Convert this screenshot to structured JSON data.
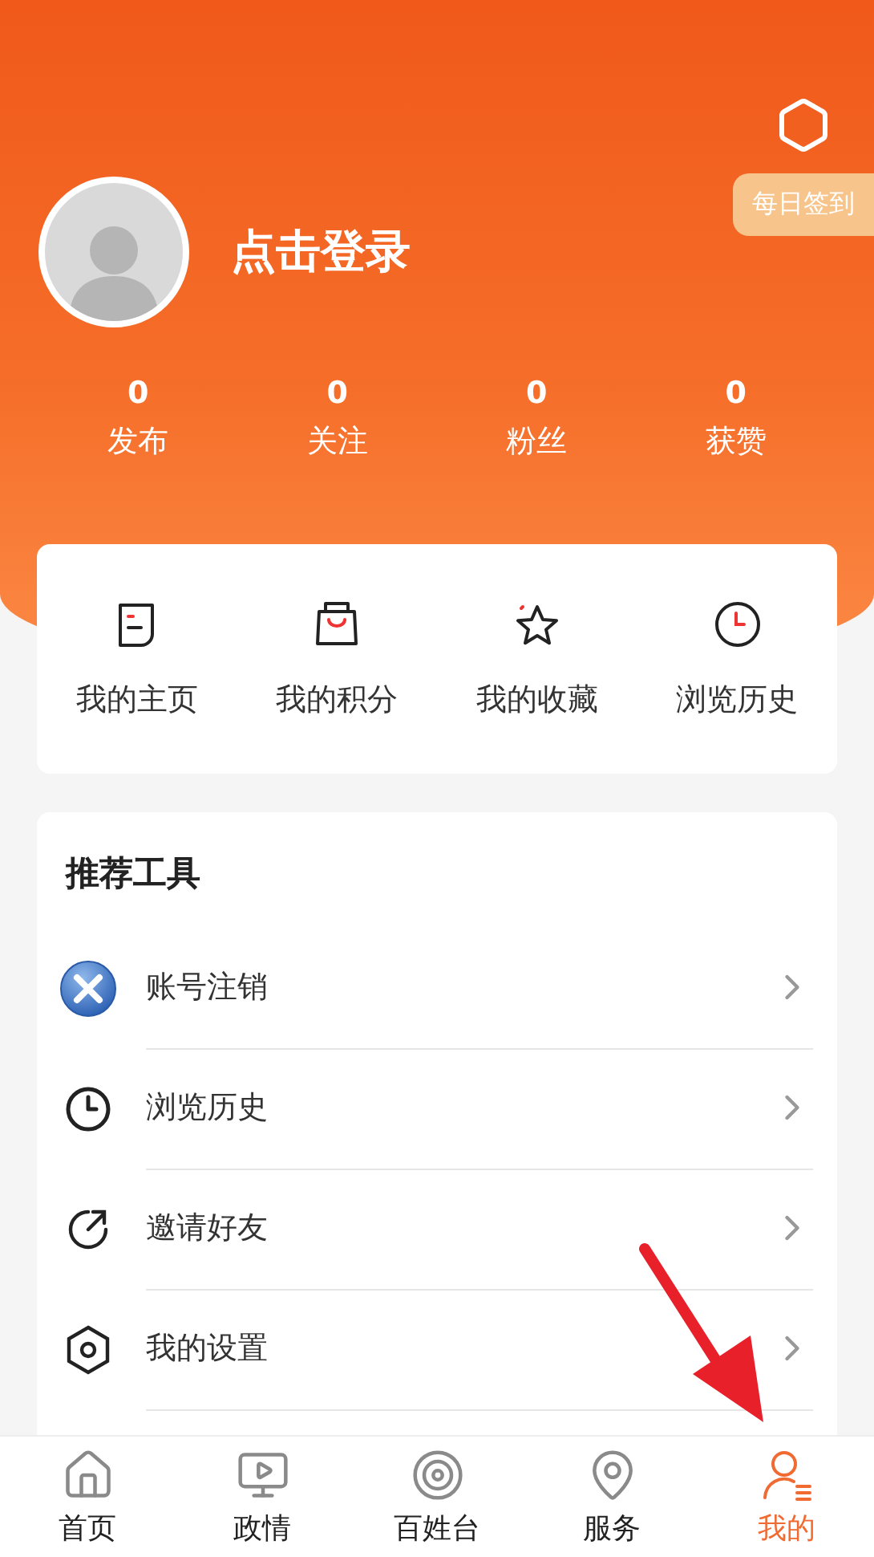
{
  "header": {
    "checkin": "每日签到",
    "login": "点击登录",
    "stats": [
      {
        "value": "0",
        "label": "发布"
      },
      {
        "value": "0",
        "label": "关注"
      },
      {
        "value": "0",
        "label": "粉丝"
      },
      {
        "value": "0",
        "label": "获赞"
      }
    ]
  },
  "shortcuts": [
    {
      "label": "我的主页",
      "kind": "page"
    },
    {
      "label": "我的积分",
      "kind": "bag"
    },
    {
      "label": "我的收藏",
      "kind": "star"
    },
    {
      "label": "浏览历史",
      "kind": "clock"
    }
  ],
  "tools": {
    "title": "推荐工具",
    "items": [
      {
        "label": "账号注销",
        "kind": "cancel"
      },
      {
        "label": "浏览历史",
        "kind": "clock"
      },
      {
        "label": "邀请好友",
        "kind": "share"
      },
      {
        "label": "我的设置",
        "kind": "settings"
      }
    ]
  },
  "tabbar": [
    {
      "label": "首页",
      "kind": "home",
      "selected": false
    },
    {
      "label": "政情",
      "kind": "video",
      "selected": false
    },
    {
      "label": "百姓台",
      "kind": "target",
      "selected": false
    },
    {
      "label": "服务",
      "kind": "map",
      "selected": false
    },
    {
      "label": "我的",
      "kind": "user",
      "selected": true
    }
  ]
}
